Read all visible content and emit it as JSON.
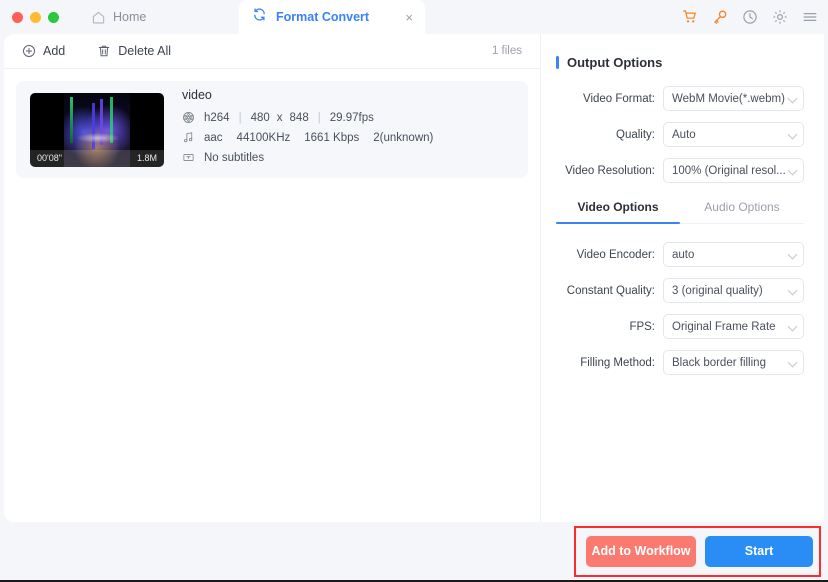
{
  "window": {
    "traffic_lights": [
      "close",
      "minimize",
      "maximize"
    ],
    "home_tab_label": "Home",
    "active_tab_label": "Format Convert",
    "close_tab_glyph": "×",
    "system_icons": [
      "cart-icon",
      "key-icon",
      "clock-icon",
      "gear-icon",
      "menu-icon"
    ],
    "accent_blue": "#3b82f6",
    "accent_orange": "#f5821f"
  },
  "toolbar": {
    "add_label": "Add",
    "delete_all_label": "Delete All",
    "files_count": "1 files"
  },
  "file": {
    "name": "video",
    "thumbnail_duration": "00'08\"",
    "thumbnail_size": "1.8M",
    "video_codec": "h264",
    "width": "480",
    "dim_sep": "x",
    "height": "848",
    "framerate": "29.97fps",
    "pipe": "|",
    "audio_codec": "aac",
    "sample_rate": "44100KHz",
    "bitrate": "1661 Kbps",
    "channels": "2(unknown)",
    "subtitles": "No subtitles"
  },
  "output_options": {
    "title": "Output Options",
    "fields": [
      {
        "label": "Video Format:",
        "value": "WebM Movie(*.webm)"
      },
      {
        "label": "Quality:",
        "value": "Auto"
      },
      {
        "label": "Video Resolution:",
        "value": "100% (Original resol..."
      }
    ]
  },
  "option_tabs": [
    {
      "label": "Video Options",
      "active": true
    },
    {
      "label": "Audio Options",
      "active": false
    }
  ],
  "video_options": {
    "fields": [
      {
        "label": "Video Encoder:",
        "value": "auto"
      },
      {
        "label": "Constant Quality:",
        "value": "3 (original quality)"
      },
      {
        "label": "FPS:",
        "value": "Original Frame Rate"
      },
      {
        "label": "Filling Method:",
        "value": "Black border filling"
      }
    ]
  },
  "actions": {
    "add_to_workflow_label": "Add to Workflow",
    "start_label": "Start",
    "highlight_color": "#ff2a2a"
  }
}
